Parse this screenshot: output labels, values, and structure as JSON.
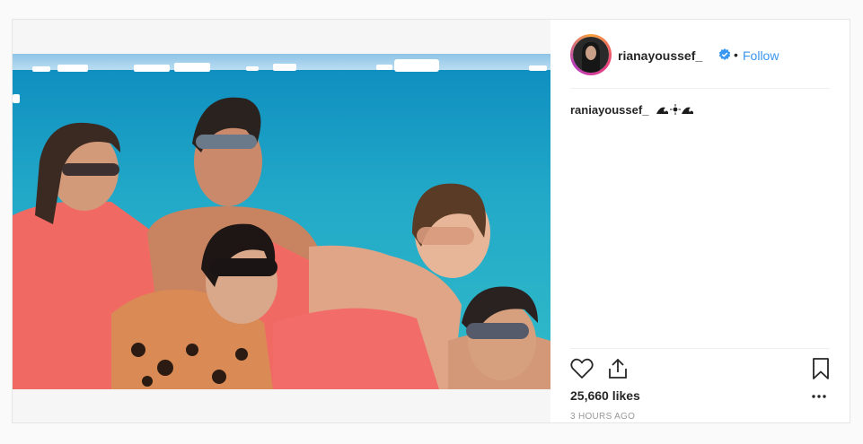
{
  "post": {
    "username": "rianayoussef_",
    "verified": true,
    "follow_label": "Follow",
    "separator": "•",
    "caption": {
      "username": "raniayoussef_",
      "emoji_icons": [
        "wave-icon",
        "sun-icon",
        "wave-icon"
      ]
    },
    "likes": "25,660 likes",
    "timestamp": "3 HOURS AGO",
    "photo_alt": "Group of friends in the sea with pink towels and sunglasses"
  },
  "colors": {
    "follow_blue": "#3897f0",
    "verified_blue": "#3897f0",
    "sea": "#2fb0c7",
    "towel": "#f16a63"
  }
}
